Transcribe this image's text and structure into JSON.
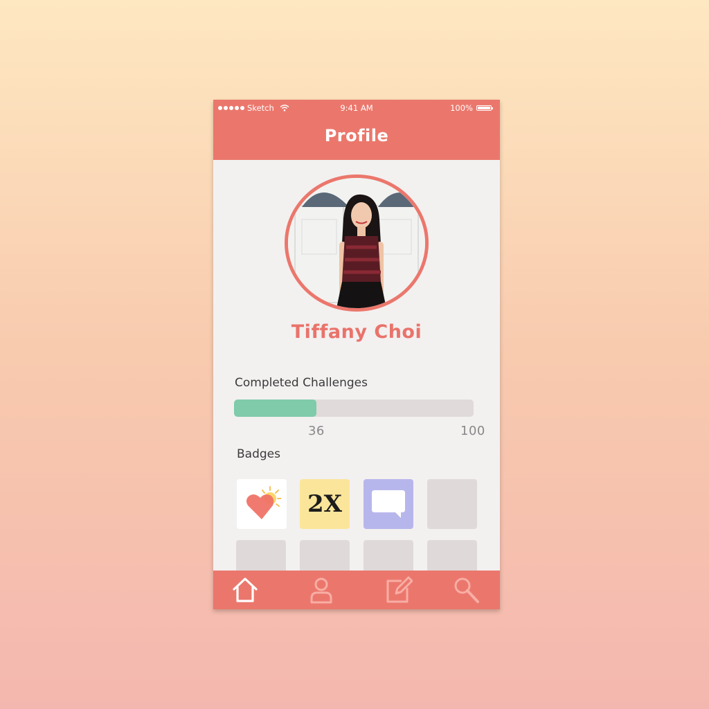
{
  "status_bar": {
    "carrier": "Sketch",
    "time": "9:41 AM",
    "battery": "100%"
  },
  "header": {
    "title": "Profile"
  },
  "profile": {
    "name": "Tiffany Choi"
  },
  "challenges": {
    "label": "Completed Challenges",
    "completed": 36,
    "total": 100,
    "completed_label": "36",
    "total_label": "100",
    "fill_color": "#7fcbaa"
  },
  "badges": {
    "label": "Badges",
    "items": [
      {
        "icon": "heart-sun-icon",
        "text": ""
      },
      {
        "icon": "2x-icon",
        "text": "2X"
      },
      {
        "icon": "speech-bubble-icon",
        "text": ""
      },
      {
        "icon": "empty-badge",
        "text": ""
      },
      {
        "icon": "empty-badge",
        "text": ""
      },
      {
        "icon": "empty-badge",
        "text": ""
      },
      {
        "icon": "empty-badge",
        "text": ""
      },
      {
        "icon": "empty-badge",
        "text": ""
      }
    ]
  },
  "tabbar": {
    "items": [
      {
        "icon": "home-icon",
        "active": true
      },
      {
        "icon": "profile-icon",
        "active": false
      },
      {
        "icon": "edit-icon",
        "active": false
      },
      {
        "icon": "search-icon",
        "active": false
      }
    ]
  },
  "colors": {
    "accent": "#eb776c",
    "name": "#e9736a",
    "progress": "#7fcbaa",
    "badge_empty": "#e0d9d9"
  }
}
